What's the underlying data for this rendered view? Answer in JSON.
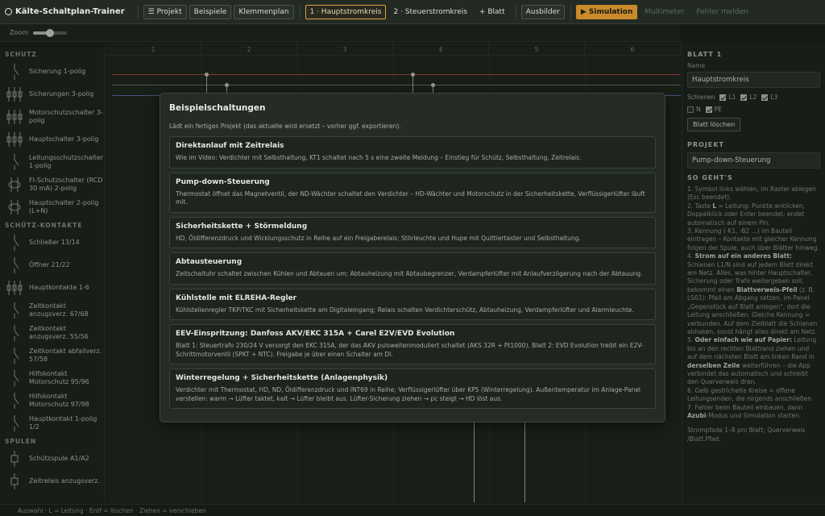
{
  "app": {
    "title": "Kälte-Schaltplan-Trainer"
  },
  "toolbar": {
    "projekt": "☰ Projekt",
    "beispiele": "Beispiele",
    "klemmenplan": "Klemmenplan",
    "tab1": "1 · Hauptstromkreis",
    "tab2": "2 · Steuerstromkreis",
    "add_sheet": "+ Blatt",
    "ausbilder": "Ausbilder",
    "simulation": "▶ Simulation",
    "multimeter": "Multimeter",
    "fehler": "Fehler melden"
  },
  "zoom": {
    "label": "Zoom",
    "level": 0.5
  },
  "sidebar": {
    "sections": [
      {
        "title": "SCHUTZ",
        "items": [
          {
            "label": "Sicherung 1-polig",
            "icon": "fuse-1pole-icon"
          },
          {
            "label": "Sicherungen 3-polig",
            "icon": "fuse-3pole-icon"
          },
          {
            "label": "Motorschutzschalter 3-polig",
            "icon": "motor-protection-icon"
          },
          {
            "label": "Hauptschalter 3-polig",
            "icon": "main-switch-icon"
          },
          {
            "label": "Leitungsschutzschalter 1-polig",
            "icon": "circuit-breaker-icon"
          },
          {
            "label": "FI-Schutzschalter (RCD 30 mA) 2-polig",
            "icon": "rcd-icon"
          },
          {
            "label": "Hauptschalter 2-polig (L+N)",
            "icon": "main-switch-2pole-icon"
          }
        ]
      },
      {
        "title": "SCHÜTZ-KONTAKTE",
        "items": [
          {
            "label": "Schließer 13/14",
            "icon": "no-contact-icon"
          },
          {
            "label": "Öffner 21/22",
            "icon": "nc-contact-icon"
          },
          {
            "label": "Hauptkontakte 1-6",
            "icon": "main-contacts-icon"
          },
          {
            "label": "Zeitkontakt anzugsverz. 67/68",
            "icon": "timer-contact-icon"
          },
          {
            "label": "Zeitkontakt anzugsverz. 55/56",
            "icon": "timer-contact-icon"
          },
          {
            "label": "Zeitkontakt abfallverz. 57/58",
            "icon": "timer-contact-icon"
          },
          {
            "label": "Hilfskontakt Motorschutz 95/96",
            "icon": "aux-contact-icon"
          },
          {
            "label": "Hilfskontakt Motorschutz 97/98",
            "icon": "aux-contact-icon"
          },
          {
            "label": "Hauptkontakt 1-polig 1/2",
            "icon": "main-contact-1pole-icon"
          }
        ]
      },
      {
        "title": "SPULEN",
        "items": [
          {
            "label": "Schützspule A1/A2",
            "icon": "coil-icon"
          },
          {
            "label": "Zeitrelais anzugsverz.",
            "icon": "timer-relay-icon"
          }
        ]
      }
    ]
  },
  "canvas": {
    "columns": [
      "1",
      "2",
      "3",
      "4",
      "5",
      "6"
    ]
  },
  "right_panel": {
    "sheet_heading": "BLATT 1",
    "name_label": "Name",
    "name_value": "Hauptstromkreis",
    "rails_label": "Schienen",
    "rails": [
      {
        "label": "L1",
        "checked": true
      },
      {
        "label": "L2",
        "checked": true
      },
      {
        "label": "L3",
        "checked": true
      },
      {
        "label": "N",
        "checked": false
      },
      {
        "label": "PE",
        "checked": true
      }
    ],
    "delete_sheet": "Blatt löschen",
    "project_heading": "PROJEKT",
    "project_value": "Pump-down-Steuerung",
    "howto_heading": "SO GEHT'S",
    "help": {
      "p1": "1. Symbol links wählen, im Raster ablegen (Esc beendet).",
      "p2a": "2. Taste ",
      "p2b": "L",
      "p2c": " = Leitung: Punkte anklicken, Doppelklick oder Enter beendet; endet automatisch auf einem Pin.",
      "p3": "3. Kennung (-K1, -B2 ...) im Bauteil eintragen – Kontakte mit gleicher Kennung folgen der Spule, auch über Blätter hinweg.",
      "p4a": "4. ",
      "p4b": "Strom auf ein anderes Blatt:",
      "p4c": " Schienen L1/N sind auf jedem Blatt direkt am Netz. Alles, was hinter Hauptschalter, Sicherung oder Trafo weitergeben soll, bekommt einen ",
      "p4d": "Blattverweis-Pfeil",
      "p4e": " (z. B. LS01): Pfeil am Abgang setzen, im Panel „Gegenstück auf Blatt anlegen\", dort die Leitung anschließen. Gleiche Kennung = verbunden. Auf dem Zielblatt die Schienen abhaken, sonst hängt alles direkt am Netz.",
      "p5a": "5. ",
      "p5b": "Oder einfach wie auf Papier:",
      "p5c": " Leitung bis an den rechten Blattrand ziehen und auf dem nächsten Blatt am linken Rand in ",
      "p5d": "derselben Zeile",
      "p5e": " weiterführen – die App verbindet das automatisch und schreibt den Querverweis dran.",
      "p6": "6. Gelb gestrichelte Kreise = offene Leitungsenden, die nirgends anschließen.",
      "p7a": "7. Fehler beim Bauteil einbauen, dann ",
      "p7b": "Azubi",
      "p7c": "-Modus und Simulation starten.",
      "p8": "Strompfade 1–8 pro Blatt; Querverweis /Blatt.Pfad."
    }
  },
  "status": {
    "text": "Auswahl · L = Leitung · Entf = löschen · Ziehen = verschieben"
  },
  "modal": {
    "title": "Beispielschaltungen",
    "subtitle": "Lädt ein fertiges Projekt (das aktuelle wird ersetzt – vorher ggf. exportieren).",
    "cards": [
      {
        "title": "Direktanlauf mit Zeitrelais",
        "desc": "Wie im Video: Verdichter mit Selbsthaltung, KT1 schaltet nach 5 s eine zweite Meldung – Einstieg für Schütz, Selbsthaltung, Zeitrelais."
      },
      {
        "title": "Pump-down-Steuerung",
        "desc": "Thermostat öffnet das Magnetventil, der ND-Wächter schaltet den Verdichter – HD-Wächter und Motorschutz in der Sicherheitskette, Verflüssigerlüfter läuft mit."
      },
      {
        "title": "Sicherheitskette + Störmeldung",
        "desc": "HD, Öldifferenzdruck und Wicklungsschutz in Reihe auf ein Freigaberelais; Störleuchte und Hupe mit Quittiertaster und Selbsthaltung."
      },
      {
        "title": "Abtausteuerung",
        "desc": "Zeitschaltuhr schaltet zwischen Kühlen und Abtauen um; Abtauheizung mit Abtaubegrenzer, Verdampferlüfter mit Anlaufverzögerung nach der Abtauung."
      },
      {
        "title": "Kühlstelle mit ELREHA-Regler",
        "desc": "Kühlstellenregler TKP/TKC mit Sicherheitskette am Digitaleingang; Relais schalten Verdichterschütz, Abtauheizung, Verdampferlüfter und Alarmleuchte."
      },
      {
        "title": "EEV-Einspritzung: Danfoss AKV/EKC 315A + Carel E2V/EVD Evolution",
        "desc": "Blatt 1: Steuertrafo 230/24 V versorgt den EKC 315A, der das AKV pulsweitenmoduliert schaltet (AKS 32R + Pt1000). Blatt 2: EVD Evolution treibt ein E2V-Schrittmotorventil (SPKT + NTC). Freigabe je über einen Schalter am DI."
      },
      {
        "title": "Winterregelung + Sicherheitskette (Anlagenphysik)",
        "desc": "Verdichter mit Thermostat, HD, ND, Öldifferenzdruck und INT69 in Reihe; Verflüssigerlüfter über KP5 (Winterregelung). Außentemperatur im Anlage-Panel verstellen: warm → Lüfter taktet, kalt → Lüfter bleibt aus. Lüfter-Sicherung ziehen → pc steigt → HD löst aus."
      }
    ]
  }
}
